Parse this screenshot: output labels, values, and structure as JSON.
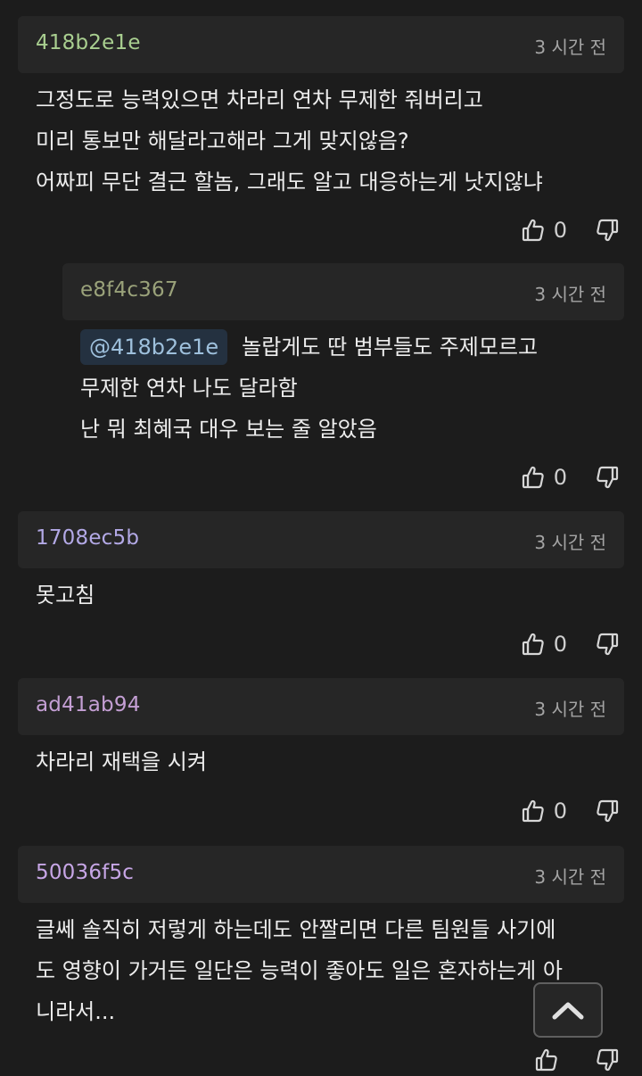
{
  "colors": {
    "background": "#1c1c1c",
    "header_bg": "#262626",
    "mention_bg": "#243140",
    "mention_text": "#9ec0dc"
  },
  "comments": [
    {
      "author": "418b2e1e",
      "author_color": "#a9cf90",
      "time": "3 시간 전",
      "lines": [
        "그정도로 능력있으면 차라리 연차 무제한 줘버리고",
        "미리 통보만 해달라고해라 그게 맞지않음?",
        "어짜피 무단 결근 할놈, 그래도 알고 대응하는게 낫지않냐"
      ],
      "likes": "0",
      "like_icon": "thumbs-up-icon",
      "dislike_icon": "thumbs-down-icon"
    },
    {
      "author": "e8f4c367",
      "author_color": "#9aa27a",
      "time": "3 시간 전",
      "mention": "@418b2e1e",
      "lines": [
        "놀랍게도 딴 범부들도 주제모르고",
        "무제한 연차 나도 달라함",
        "난 뭐 최혜국 대우 보는 줄 알았음"
      ],
      "likes": "0",
      "like_icon": "thumbs-up-icon",
      "dislike_icon": "thumbs-down-icon"
    },
    {
      "author": "1708ec5b",
      "author_color": "#b3a9e6",
      "time": "3 시간 전",
      "lines": [
        "못고침"
      ],
      "likes": "0",
      "like_icon": "thumbs-up-icon",
      "dislike_icon": "thumbs-down-icon"
    },
    {
      "author": "ad41ab94",
      "author_color": "#c49fd4",
      "time": "3 시간 전",
      "lines": [
        "차라리 재택을 시켜"
      ],
      "likes": "0",
      "like_icon": "thumbs-up-icon",
      "dislike_icon": "thumbs-down-icon"
    },
    {
      "author": "50036f5c",
      "author_color": "#c7a6e6",
      "time": "3 시간 전",
      "lines": [
        "글쎄 솔직히 저렇게 하는데도 안짤리면 다른 팀원들 사기에",
        "도 영향이 가거든 일단은 능력이 좋아도 일은 혼자하는게 아",
        "니라서..."
      ],
      "likes": "",
      "like_icon": "thumbs-up-icon",
      "dislike_icon": "thumbs-down-icon"
    }
  ],
  "scroll_top": {
    "icon": "chevron-up-icon"
  }
}
